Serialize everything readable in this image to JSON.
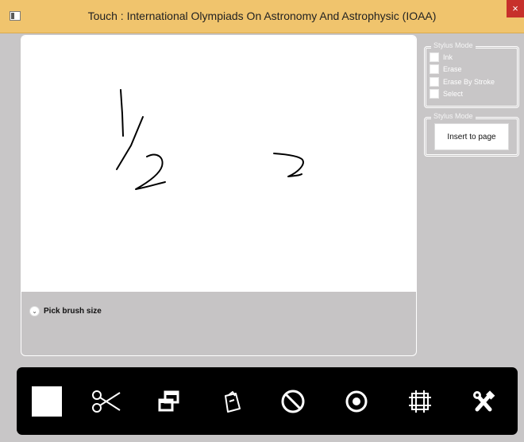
{
  "window": {
    "title": "Touch : International Olympiads On Astronomy And Astrophysic (IOAA)",
    "close_glyph": "×"
  },
  "canvas": {
    "brush_toggle_label": "Pick brush size"
  },
  "stylus_mode": {
    "legend": "Stylus Mode",
    "options": [
      {
        "label": "Ink",
        "checked": false
      },
      {
        "label": "Erase",
        "checked": false
      },
      {
        "label": "Erase By Stroke",
        "checked": false
      },
      {
        "label": "Select",
        "checked": false
      }
    ]
  },
  "insert_group": {
    "legend": "Stylus Mode",
    "button_label": "Insert to page"
  },
  "toolbar": {
    "tools": [
      {
        "name": "color-swatch",
        "icon": "white-square"
      },
      {
        "name": "cut",
        "icon": "scissors-icon"
      },
      {
        "name": "copy",
        "icon": "copy-windows-icon"
      },
      {
        "name": "paste",
        "icon": "clipboard-icon"
      },
      {
        "name": "cancel",
        "icon": "prohibited-icon"
      },
      {
        "name": "record",
        "icon": "target-icon"
      },
      {
        "name": "frame",
        "icon": "frame-icon"
      },
      {
        "name": "tools",
        "icon": "tools-icon"
      }
    ]
  },
  "colors": {
    "titlebar": "#f0c46d",
    "close": "#c7302b",
    "toolbar": "#000000",
    "background": "#c8c6c7"
  }
}
